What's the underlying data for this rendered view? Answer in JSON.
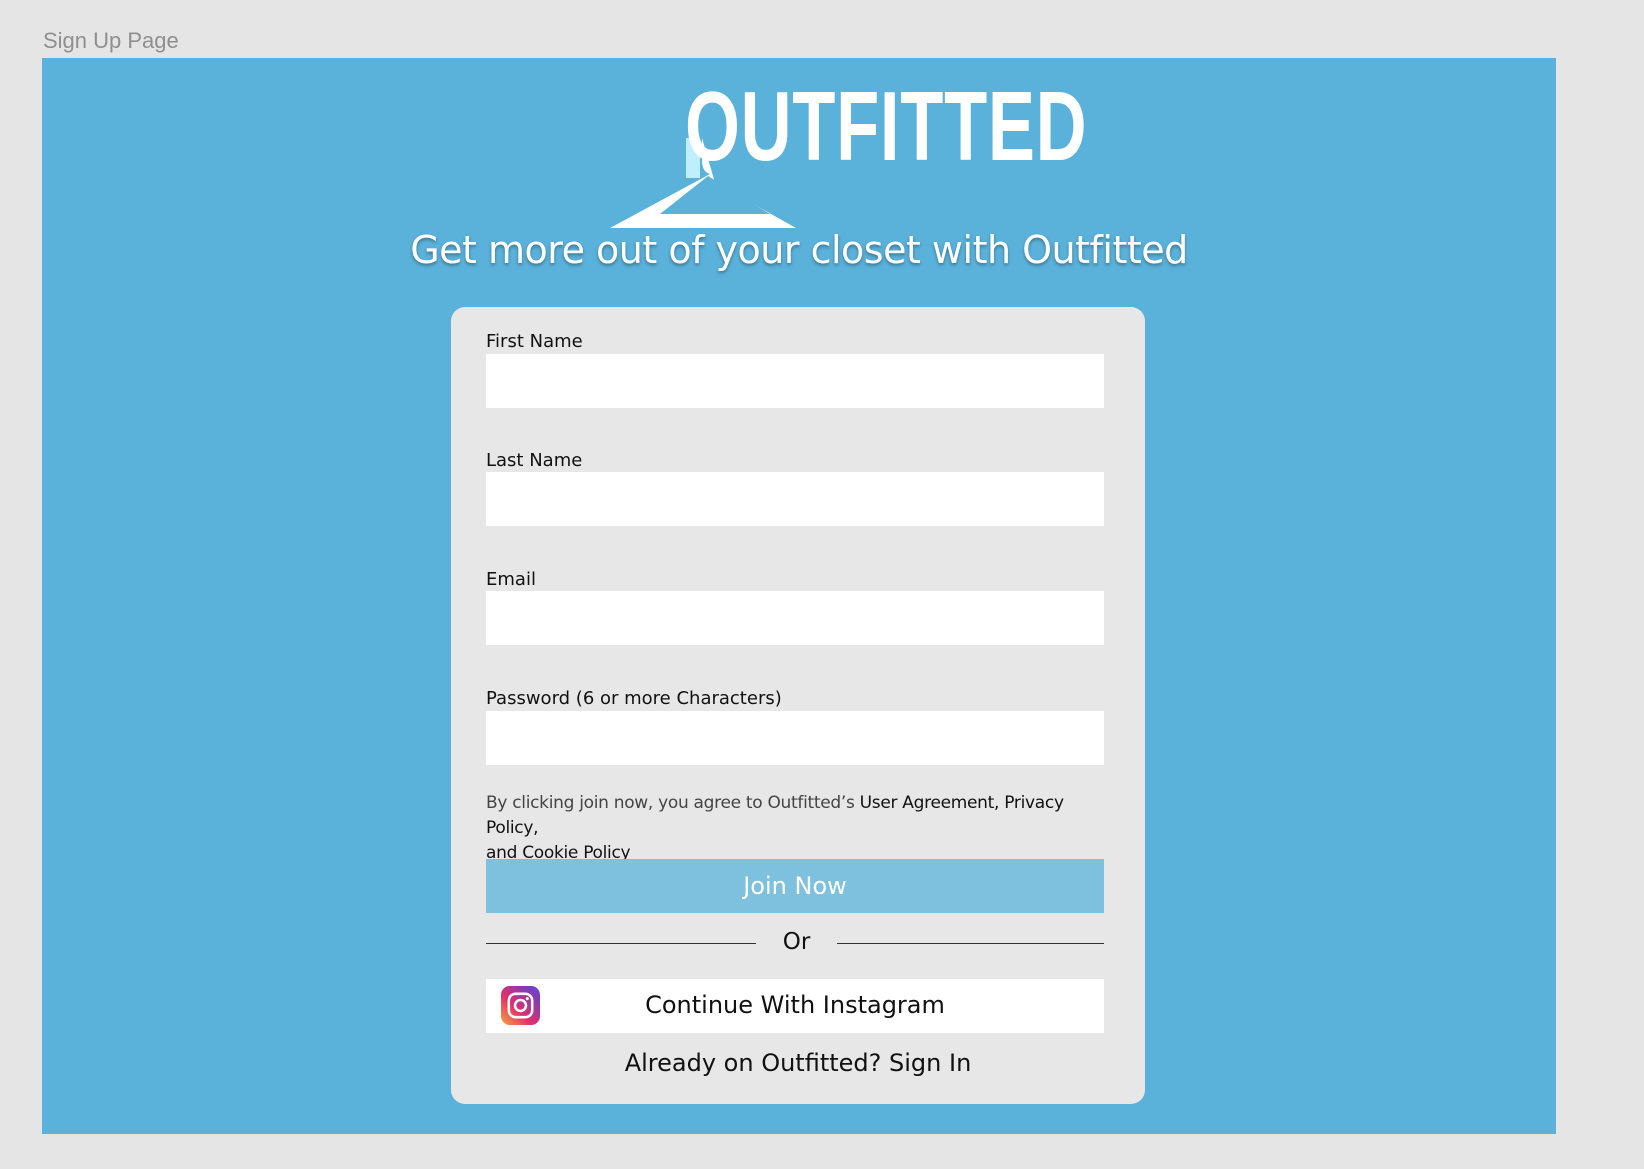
{
  "frame": {
    "label": "Sign Up Page"
  },
  "brand": {
    "logo_text": "OUTFITTED",
    "tagline": "Get more out of your closet with Outfitted"
  },
  "form": {
    "fields": [
      {
        "label": "First Name",
        "value": "",
        "placeholder": ""
      },
      {
        "label": "Last Name",
        "value": "",
        "placeholder": ""
      },
      {
        "label": "Email",
        "value": "",
        "placeholder": ""
      },
      {
        "label": "Password (6 or more Characters)",
        "value": "",
        "placeholder": ""
      }
    ],
    "terms": {
      "prefix": "By clicking join now, you agree to Outfitted’s ",
      "user_agreement": "User Agreement,",
      "privacy_policy": "Privacy Policy,",
      "and_text": "and ",
      "cookie_policy": "Cookie Policy"
    },
    "join_label": "Join Now",
    "divider_text": "Or",
    "instagram_label": "Continue With Instagram",
    "signin_text": "Already on Outfitted? Sign In"
  },
  "icons": {
    "logo": "hanger-logo-icon",
    "instagram": "instagram-icon"
  },
  "colors": {
    "background": "#5ab1da",
    "card": "#e7e7e7",
    "join_button": "#7dc1de",
    "outer": "#e5e5e5"
  }
}
